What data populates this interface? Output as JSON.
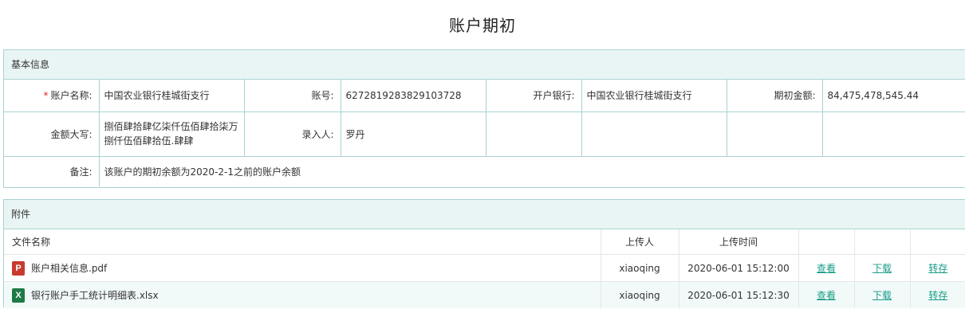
{
  "page_title": "账户期初",
  "basic": {
    "section_title": "基本信息",
    "required_mark": "*",
    "account_name_label": "账户名称:",
    "account_name": "中国农业银行桂城街支行",
    "account_no_label": "账号:",
    "account_no": "6272819283829103728",
    "bank_label": "开户银行:",
    "bank": "中国农业银行桂城街支行",
    "opening_amount_label": "期初金额:",
    "opening_amount": "84,475,478,545.44",
    "amount_words_label": "金额大写:",
    "amount_words": "捌佰肆拾肆亿柒仟伍佰肆拾柒万捌仟伍佰肆拾伍.肆肆",
    "entered_by_label": "录入人:",
    "entered_by": "罗丹",
    "remark_label": "备注:",
    "remark": "该账户的期初余额为2020-2-1之前的账户余额"
  },
  "attachments": {
    "section_title": "附件",
    "headers": {
      "file_name": "文件名称",
      "uploader": "上传人",
      "upload_time": "上传时间"
    },
    "actions": {
      "view": "查看",
      "download": "下载",
      "forward": "转存"
    },
    "files": [
      {
        "icon": "pdf-file-icon",
        "glyph": "P",
        "name": "账户相关信息.pdf",
        "uploader": "xiaoqing",
        "time": "2020-06-01 15:12:00"
      },
      {
        "icon": "excel-file-icon",
        "glyph": "X",
        "name": "银行账户手工统计明细表.xlsx",
        "uploader": "xiaoqing",
        "time": "2020-06-01 15:12:30"
      }
    ]
  },
  "colors": {
    "border": "#a9d3d2",
    "header_bg": "#e9f5f4",
    "link": "#1a9c88",
    "required": "#e02424"
  }
}
